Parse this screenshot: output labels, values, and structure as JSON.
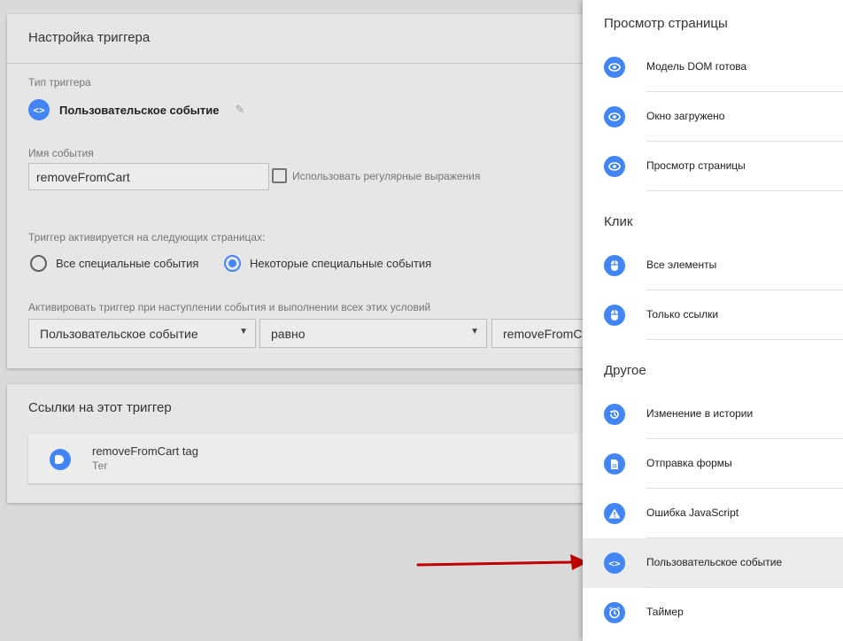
{
  "trigger_card": {
    "title": "Настройка триггера",
    "type_label": "Тип триггера",
    "type_value": "Пользовательское событие",
    "event_name_label": "Имя события",
    "event_name_value": "removeFromCart",
    "regex_label": "Использовать регулярные выражения",
    "fires_on_label": "Триггер активируется на следующих страницах:",
    "radio_all": "Все специальные события",
    "radio_some": "Некоторые специальные события",
    "condition_label": "Активировать триггер при наступлении события и выполнении всех этих условий",
    "condition_variable": "Пользовательское событие",
    "condition_operator": "равно",
    "condition_value": "removeFromCart"
  },
  "refs_card": {
    "title": "Ссылки на этот триггер",
    "item_name": "removeFromCart tag",
    "item_type": "Тег"
  },
  "panel": {
    "sections": [
      {
        "title": "Просмотр страницы",
        "items": [
          {
            "label": "Модель DOM готова",
            "icon": "eye-icon"
          },
          {
            "label": "Окно загружено",
            "icon": "eye-icon"
          },
          {
            "label": "Просмотр страницы",
            "icon": "eye-icon"
          }
        ]
      },
      {
        "title": "Клик",
        "items": [
          {
            "label": "Все элементы",
            "icon": "mouse-icon"
          },
          {
            "label": "Только ссылки",
            "icon": "mouse-icon"
          }
        ]
      },
      {
        "title": "Другое",
        "items": [
          {
            "label": "Изменение в истории",
            "icon": "history-icon"
          },
          {
            "label": "Отправка формы",
            "icon": "form-icon"
          },
          {
            "label": "Ошибка JavaScript",
            "icon": "warning-icon"
          },
          {
            "label": "Пользовательское событие",
            "icon": "code-icon"
          },
          {
            "label": "Таймер",
            "icon": "timer-icon"
          }
        ]
      }
    ]
  },
  "colors": {
    "accent": "#4285f4",
    "arrow": "#c00000"
  }
}
